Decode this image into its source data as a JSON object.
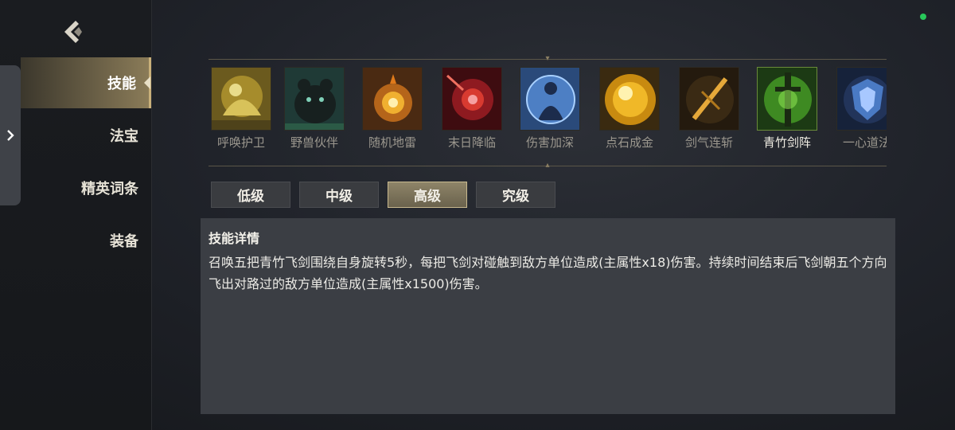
{
  "sidebar": {
    "items": [
      {
        "label": "技能",
        "active": true
      },
      {
        "label": "法宝",
        "active": false
      },
      {
        "label": "精英词条",
        "active": false
      },
      {
        "label": "装备",
        "active": false
      }
    ]
  },
  "skills": [
    {
      "label": "呼唤护卫",
      "icon": "golden-guardian-icon",
      "selected": false
    },
    {
      "label": "野兽伙伴",
      "icon": "bear-beast-icon",
      "selected": false
    },
    {
      "label": "随机地雷",
      "icon": "mine-bomb-icon",
      "selected": false
    },
    {
      "label": "末日降临",
      "icon": "doom-meteor-icon",
      "selected": false
    },
    {
      "label": "伤害加深",
      "icon": "blue-spirit-icon",
      "selected": false
    },
    {
      "label": "点石成金",
      "icon": "golden-orb-icon",
      "selected": false
    },
    {
      "label": "剑气连斩",
      "icon": "sword-slash-icon",
      "selected": false
    },
    {
      "label": "青竹剑阵",
      "icon": "bamboo-sword-icon",
      "selected": true
    },
    {
      "label": "一心道法",
      "icon": "blue-shield-icon",
      "selected": false
    }
  ],
  "levels": [
    {
      "label": "低级",
      "active": false
    },
    {
      "label": "中级",
      "active": false
    },
    {
      "label": "高级",
      "active": true
    },
    {
      "label": "究级",
      "active": false
    }
  ],
  "detail": {
    "title": "技能详情",
    "body": "召唤五把青竹飞剑围绕自身旋转5秒，每把飞剑对碰触到敌方单位造成(主属性x18)伤害。持续时间结束后飞剑朝五个方向飞出对路过的敌方单位造成(主属性x1500)伤害。"
  },
  "colors": {
    "accent_gold": "#c9b07a",
    "active_tab": "#8e8468",
    "panel_bg": "#3b3e44",
    "status_dot": "#28c85a"
  }
}
